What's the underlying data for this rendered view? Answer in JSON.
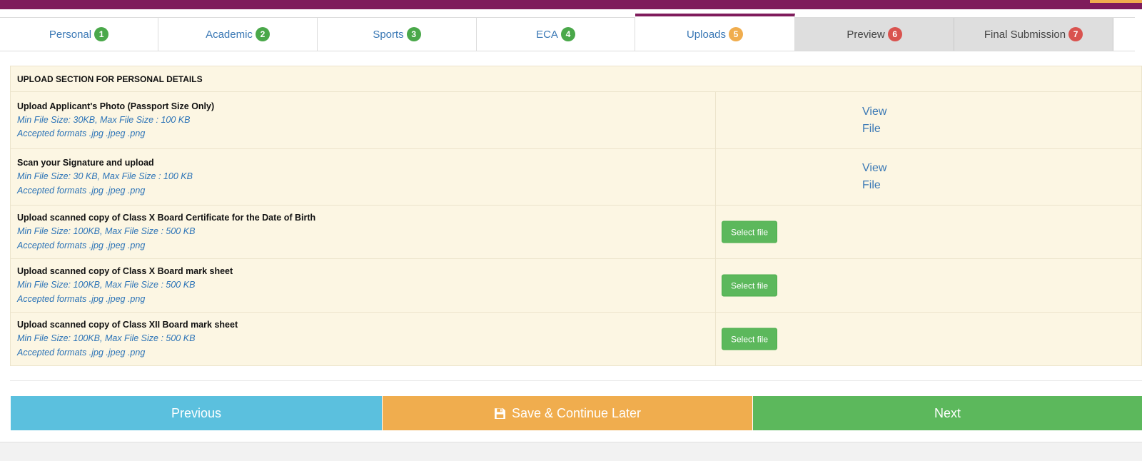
{
  "tabs": [
    {
      "label": "Personal",
      "num": "1",
      "state": "done"
    },
    {
      "label": "Academic",
      "num": "2",
      "state": "done"
    },
    {
      "label": "Sports",
      "num": "3",
      "state": "done"
    },
    {
      "label": "ECA",
      "num": "4",
      "state": "done"
    },
    {
      "label": "Uploads",
      "num": "5",
      "state": "active"
    },
    {
      "label": "Preview",
      "num": "6",
      "state": "disabled"
    },
    {
      "label": "Final Submission",
      "num": "7",
      "state": "disabled"
    }
  ],
  "section_title": "UPLOAD SECTION FOR PERSONAL DETAILS",
  "rows": [
    {
      "title": "Upload Applicant's Photo (Passport Size Only)",
      "size": "Min File Size: 30KB, Max File Size : 100 KB",
      "formats": "Accepted formats .jpg .jpeg .png",
      "action": "View File"
    },
    {
      "title": "Scan your Signature and upload",
      "size": "Min File Size: 30 KB, Max File Size : 100 KB",
      "formats": "Accepted formats .jpg .jpeg .png",
      "action": "View File"
    },
    {
      "title": "Upload scanned copy of Class X Board Certificate for the Date of Birth",
      "size": "Min File Size: 100KB, Max File Size : 500 KB",
      "formats": "Accepted formats .jpg .jpeg .png",
      "action": "Select file"
    },
    {
      "title": "Upload scanned copy of Class X Board mark sheet",
      "size": "Min File Size: 100KB, Max File Size : 500 KB",
      "formats": "Accepted formats .jpg .jpeg .png",
      "action": "Select file"
    },
    {
      "title": "Upload scanned copy of Class XII Board mark sheet",
      "size": "Min File Size: 100KB, Max File Size : 500 KB",
      "formats": "Accepted formats .jpg .jpeg .png",
      "action": "Select file"
    }
  ],
  "buttons": {
    "previous": "Previous",
    "save": "Save & Continue Later",
    "next": "Next"
  },
  "colors": {
    "brand": "#7f1c5c",
    "done_badge": "#4aa84a",
    "active_badge": "#f0ad4e",
    "disabled_badge": "#d9534f",
    "row_bg": "#fcf6e3",
    "link": "#3a78b5"
  },
  "icons": {
    "save": "floppy-disk-icon"
  }
}
